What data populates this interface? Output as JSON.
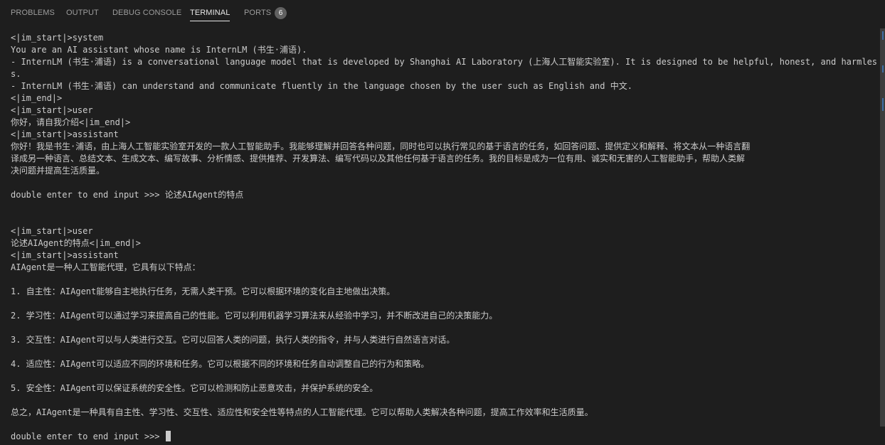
{
  "tabs": [
    {
      "label": "PROBLEMS"
    },
    {
      "label": "OUTPUT"
    },
    {
      "label": "DEBUG CONSOLE"
    },
    {
      "label": "TERMINAL"
    },
    {
      "label": "PORTS"
    }
  ],
  "ports_badge": "6",
  "terminal": {
    "lines": [
      "<|im_start|>system",
      "You are an AI assistant whose name is InternLM (书生·浦语).",
      "- InternLM (书生·浦语) is a conversational language model that is developed by Shanghai AI Laboratory (上海人工智能实验室). It is designed to be helpful, honest, and harmles",
      "s.",
      "- InternLM (书生·浦语) can understand and communicate fluently in the language chosen by the user such as English and 中文.",
      "<|im_end|>",
      "<|im_start|>user",
      "你好，请自我介绍<|im_end|>",
      "<|im_start|>assistant",
      "你好！我是书生·浦语，由上海人工智能实验室开发的一款人工智能助手。我能够理解并回答各种问题，同时也可以执行常见的基于语言的任务，如回答问题、提供定义和解释、将文本从一种语言翻",
      "译成另一种语言、总结文本、生成文本、编写故事、分析情感、提供推荐、开发算法、编写代码以及其他任何基于语言的任务。我的目标是成为一位有用、诚实和无害的人工智能助手，帮助人类解",
      "决问题并提高生活质量。",
      "",
      "double enter to end input >>> 论述AIAgent的特点",
      "",
      "",
      "<|im_start|>user",
      "论述AIAgent的特点<|im_end|>",
      "<|im_start|>assistant",
      "AIAgent是一种人工智能代理，它具有以下特点：",
      "",
      "1. 自主性：AIAgent能够自主地执行任务，无需人类干预。它可以根据环境的变化自主地做出决策。",
      "",
      "2. 学习性：AIAgent可以通过学习来提高自己的性能。它可以利用机器学习算法来从经验中学习，并不断改进自己的决策能力。",
      "",
      "3. 交互性：AIAgent可以与人类进行交互。它可以回答人类的问题，执行人类的指令，并与人类进行自然语言对话。",
      "",
      "4. 适应性：AIAgent可以适应不同的环境和任务。它可以根据不同的环境和任务自动调整自己的行为和策略。",
      "",
      "5. 安全性：AIAgent可以保证系统的安全性。它可以检测和防止恶意攻击，并保护系统的安全。",
      "",
      "总之，AIAgent是一种具有自主性、学习性、交互性、适应性和安全性等特点的人工智能代理。它可以帮助人类解决各种问题，提高工作效率和生活质量。",
      ""
    ],
    "prompt": "double enter to end input >>> "
  },
  "colors": {
    "background": "#1e1e1e",
    "text": "#cccccc",
    "active_tab": "#e7e7e7",
    "inactive_tab": "#9d9d9d",
    "badge": "#616161"
  }
}
